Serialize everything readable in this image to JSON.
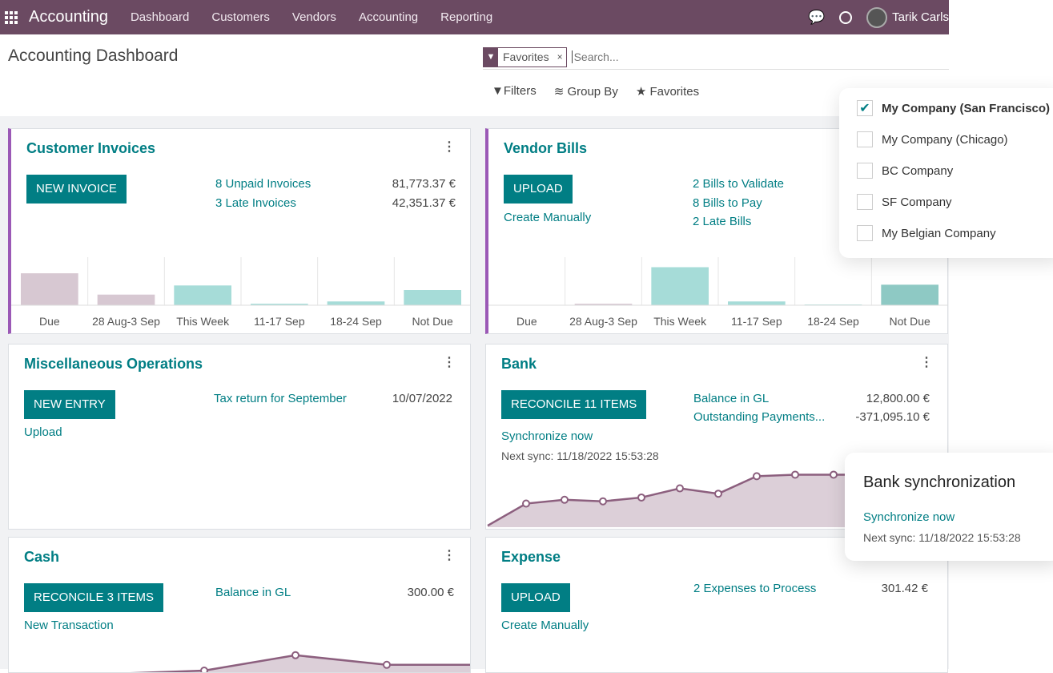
{
  "nav": {
    "app": "Accounting",
    "menu": [
      "Dashboard",
      "Customers",
      "Vendors",
      "Accounting",
      "Reporting"
    ],
    "user": "Tarik Carls"
  },
  "page_title": "Accounting Dashboard",
  "search": {
    "facet": "Favorites",
    "placeholder": "Search...",
    "tools": [
      "Filters",
      "Group By",
      "Favorites"
    ]
  },
  "colors": {
    "navbar": "#6b4a62",
    "primary": "#017e84",
    "accent": "#9b59b6"
  },
  "companies": [
    {
      "label": "My Company (San Francisco)",
      "checked": true
    },
    {
      "label": "My Company (Chicago)",
      "checked": false
    },
    {
      "label": "BC Company",
      "checked": false
    },
    {
      "label": "SF Company",
      "checked": false
    },
    {
      "label": "My Belgian Company",
      "checked": false
    }
  ],
  "customer_invoices": {
    "title": "Customer Invoices",
    "button": "New Invoice",
    "links": [
      {
        "label": "8 Unpaid Invoices",
        "amount": "81,773.37 €"
      },
      {
        "label": "3 Late Invoices",
        "amount": "42,351.37 €"
      }
    ],
    "chart_data": {
      "type": "bar",
      "categories": [
        "Due",
        "28 Aug-3 Sep",
        "This Week",
        "11-17 Sep",
        "18-24 Sep",
        "Not Due"
      ],
      "values": [
        42,
        14,
        26,
        2,
        5,
        20
      ],
      "colors": [
        "#d7c8d2",
        "#d7c8d2",
        "#a6dcd8",
        "#a6dcd8",
        "#a6dcd8",
        "#a6dcd8"
      ]
    }
  },
  "vendor_bills": {
    "title": "Vendor Bills",
    "button": "Upload",
    "secondary": "Create Manually",
    "links": [
      "2 Bills to Validate",
      "8 Bills to Pay",
      "2 Late Bills"
    ],
    "chart_data": {
      "type": "bar",
      "categories": [
        "Due",
        "28 Aug-3 Sep",
        "This Week",
        "11-17 Sep",
        "18-24 Sep",
        "Not Due"
      ],
      "values": [
        0,
        2,
        50,
        5,
        1,
        27
      ],
      "colors": [
        "#d7c8d2",
        "#d7c8d2",
        "#a6dcd8",
        "#a6dcd8",
        "#a6dcd8",
        "#8ec9c4"
      ]
    }
  },
  "misc": {
    "title": "Miscellaneous Operations",
    "button": "New Entry",
    "secondary": "Upload",
    "link": "Tax return for September",
    "date": "10/07/2022"
  },
  "bank": {
    "title": "Bank",
    "button": "Reconcile 11 Items",
    "sync": "Synchronize now",
    "next_sync": "Next sync: 11/18/2022 15:53:28",
    "links": [
      {
        "label": "Balance in GL",
        "amount": "12,800.00 €"
      },
      {
        "label": "Outstanding Payments...",
        "amount": "-371,095.10 €"
      }
    ],
    "chart_data": {
      "type": "area",
      "values": [
        2,
        31,
        36,
        34,
        39,
        51,
        44,
        67,
        69,
        69,
        69,
        69
      ]
    }
  },
  "cash": {
    "title": "Cash",
    "button": "Reconcile 3 Items",
    "secondary": "New Transaction",
    "link": "Balance in GL",
    "amount": "300.00 €",
    "chart_data": {
      "type": "area",
      "values": [
        0,
        5,
        29,
        14,
        14
      ]
    }
  },
  "expense": {
    "title": "Expense",
    "button": "Upload",
    "secondary": "Create Manually",
    "link": "2 Expenses to Process",
    "amount": "301.42 €"
  },
  "bank_sync_popup": {
    "title": "Bank synchronization",
    "link": "Synchronize now",
    "next_sync": "Next sync: 11/18/2022 15:53:28"
  }
}
